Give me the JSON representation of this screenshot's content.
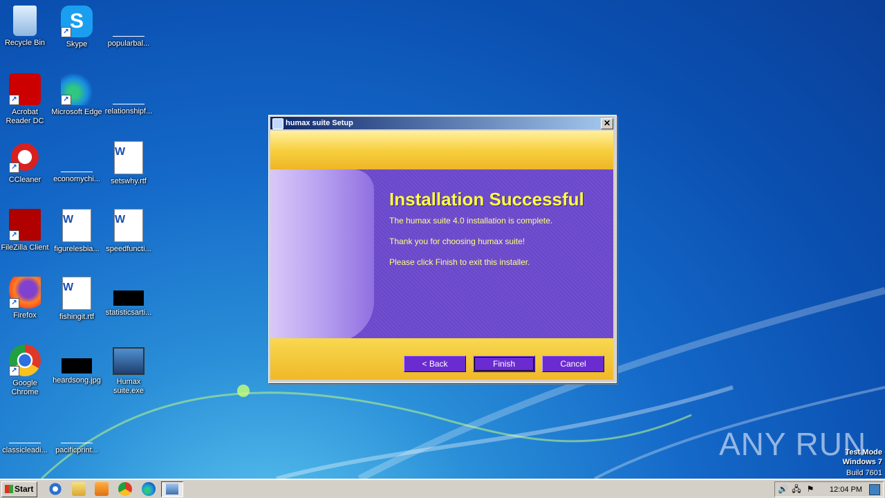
{
  "desktop": {
    "icons": [
      {
        "label": "Recycle Bin"
      },
      {
        "label": "Skype"
      },
      {
        "label": "popularbal..."
      },
      {
        "label": "Acrobat Reader DC"
      },
      {
        "label": "Microsoft Edge"
      },
      {
        "label": "relationshipf..."
      },
      {
        "label": "CCleaner"
      },
      {
        "label": "economychi..."
      },
      {
        "label": "setswhy.rtf"
      },
      {
        "label": "FileZilla Client"
      },
      {
        "label": "figurelesbia..."
      },
      {
        "label": "speedfuncti..."
      },
      {
        "label": "Firefox"
      },
      {
        "label": "fishingit.rtf"
      },
      {
        "label": "statisticsarti..."
      },
      {
        "label": "Google Chrome"
      },
      {
        "label": "heardsong.jpg"
      },
      {
        "label": "Humax suite.exe"
      },
      {
        "label": "classicleadi..."
      },
      {
        "label": "pacificprint..."
      }
    ]
  },
  "window": {
    "title": "humax suite Setup",
    "close": "✕",
    "heading": "Installation Successful",
    "lines": [
      "The humax suite 4.0 installation is complete.",
      "Thank you for choosing humax suite!",
      "Please click Finish to exit this installer."
    ],
    "buttons": {
      "back": "< Back",
      "finish": "Finish",
      "cancel": "Cancel"
    }
  },
  "taskbar": {
    "start": "Start",
    "clock": "12:04 PM"
  },
  "watermark": {
    "line1": "Test Mode",
    "line2": "Windows 7",
    "line3": "Build 7601",
    "brand": "ANY RUN"
  }
}
